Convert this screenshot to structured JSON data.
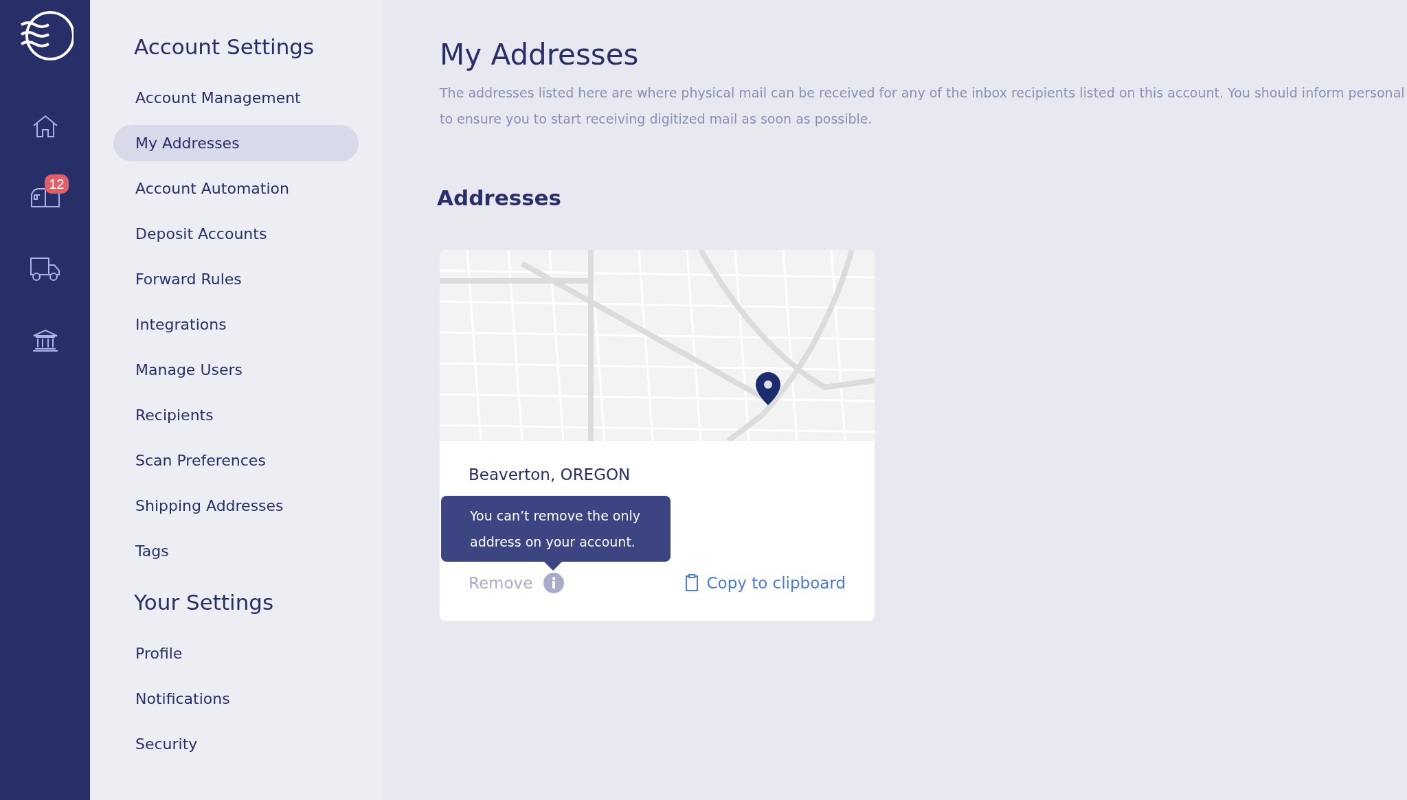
{
  "rail": {
    "items": [
      {
        "kind": "home",
        "selected": false
      },
      {
        "kind": "mailbox",
        "selected": false,
        "badge": "12"
      },
      {
        "kind": "truck",
        "selected": false
      },
      {
        "kind": "bank",
        "selected": false
      }
    ]
  },
  "settings_nav": {
    "sections": [
      {
        "title": "Account Settings",
        "items": [
          {
            "label": "Account Management",
            "selected": false
          },
          {
            "label": "My Addresses",
            "selected": true
          },
          {
            "label": "Account Automation",
            "selected": false
          },
          {
            "label": "Deposit Accounts",
            "selected": false
          },
          {
            "label": "Forward Rules",
            "selected": false
          },
          {
            "label": "Integrations",
            "selected": false
          },
          {
            "label": "Manage Users",
            "selected": false
          },
          {
            "label": "Recipients",
            "selected": false
          },
          {
            "label": "Scan Preferences",
            "selected": false
          },
          {
            "label": "Shipping Addresses",
            "selected": false
          },
          {
            "label": "Tags",
            "selected": false
          }
        ]
      },
      {
        "title": "Your Settings",
        "items": [
          {
            "label": "Profile",
            "selected": false
          },
          {
            "label": "Notifications",
            "selected": false
          },
          {
            "label": "Security",
            "selected": false
          }
        ]
      }
    ]
  },
  "main": {
    "title": "My Addresses",
    "description_lines": [
      "The addresses listed here are where physical mail can be received for any of the inbox recipients listed on this account. You should inform personal",
      "to ensure you to start receiving digitized mail as soon as possible."
    ],
    "section_title": "Addresses",
    "addresses": [
      {
        "location": "Beaverton, OREGON",
        "tooltip": "You can’t remove the only address on your account.",
        "remove_label": "Remove",
        "remove_disabled": true,
        "copy_label": "Copy to clipboard"
      }
    ]
  }
}
